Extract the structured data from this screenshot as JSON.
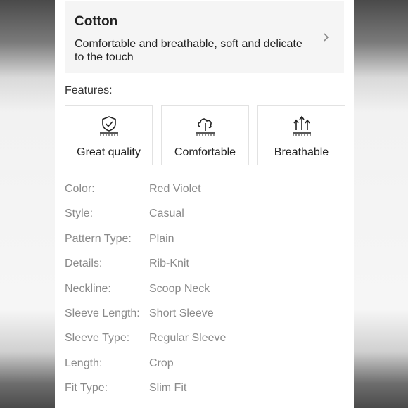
{
  "material": {
    "title": "Cotton",
    "description": "Comfortable and breathable, soft and delicate to the touch"
  },
  "features": {
    "label": "Features:",
    "items": [
      {
        "label": "Great quality",
        "icon": "shield-check-icon"
      },
      {
        "label": "Comfortable",
        "icon": "cloud-icon"
      },
      {
        "label": "Breathable",
        "icon": "arrows-up-icon"
      }
    ]
  },
  "attributes": [
    {
      "key": "Color:",
      "value": "Red Violet"
    },
    {
      "key": "Style:",
      "value": "Casual"
    },
    {
      "key": "Pattern Type:",
      "value": "Plain"
    },
    {
      "key": "Details:",
      "value": "Rib-Knit"
    },
    {
      "key": "Neckline:",
      "value": "Scoop Neck"
    },
    {
      "key": "Sleeve Length:",
      "value": "Short Sleeve"
    },
    {
      "key": "Sleeve Type:",
      "value": "Regular Sleeve"
    },
    {
      "key": "Length:",
      "value": "Crop"
    },
    {
      "key": "Fit Type:",
      "value": "Slim Fit"
    }
  ]
}
